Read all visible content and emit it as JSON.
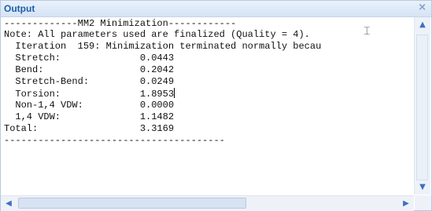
{
  "panel": {
    "title": "Output",
    "close_icon": "close-icon"
  },
  "output": {
    "lines": [
      "-------------MM2 Minimization------------",
      "Note: All parameters used are finalized (Quality = 4).",
      "  Iteration  159: Minimization terminated normally becau",
      "  Stretch:              0.0443",
      "  Bend:                 0.2042",
      "  Stretch-Bend:         0.0249",
      "  Torsion:              1.8953",
      "  Non-1,4 VDW:          0.0000",
      "  1,4 VDW:              1.1482",
      "Total:                  3.3169",
      "---------------------------------------"
    ]
  },
  "scrollbars": {
    "vertical": {
      "up_icon": "chevron-up-icon",
      "down_icon": "chevron-down-icon"
    },
    "horizontal": {
      "left_icon": "chevron-left-icon",
      "right_icon": "chevron-right-icon"
    }
  }
}
